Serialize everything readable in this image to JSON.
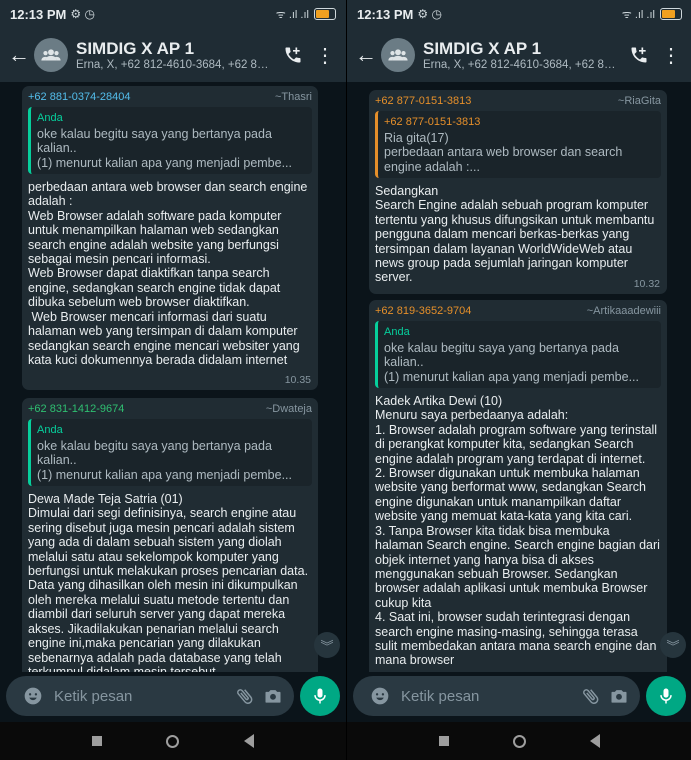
{
  "colors": {
    "accent": "#00a884",
    "background": "#0b141a",
    "bubble": "#202c33",
    "header": "#1f2c34"
  },
  "status": {
    "time": "12:13 PM",
    "icons_left": "⚙ ◷",
    "signal": "ᯤ .ıl .ıl"
  },
  "header": {
    "title": "SIMDIG X AP 1",
    "members": "Erna, X, +62 812-4610-3684, +62 815-2..."
  },
  "composer": {
    "placeholder": "Ketik pesan"
  },
  "left": {
    "messages": [
      {
        "sender": "+62 881-0374-28404",
        "alias": "~Thasri",
        "quote_author": "Anda",
        "quote_text": "oke kalau begitu saya yang bertanya pada kalian..\n(1) menurut kalian apa yang menjadi pembe...",
        "text": "perbedaan antara web browser dan search engine adalah :\nWeb Browser adalah software pada komputer untuk menampilkan halaman web sedangkan search engine adalah website yang berfungsi sebagai mesin pencari informasi.\nWeb Browser dapat diaktifkan tanpa search engine, sedangkan search engine tidak dapat dibuka sebelum web browser diaktifkan.\n Web Browser mencari informasi dari suatu halaman web yang tersimpan di dalam komputer sedangkan search engine mencari websiter yang kata kuci dokumennya berada didalam internet",
        "time": "10.35"
      },
      {
        "sender": "+62 831-1412-9674",
        "alias": "~Dwateja",
        "quote_author": "Anda",
        "quote_text": "oke kalau begitu saya yang bertanya pada kalian..\n(1) menurut kalian apa yang menjadi pembe...",
        "text": "Dewa Made Teja Satria (01)\nDimulai dari segi definisinya, search engine atau sering disebut juga mesin pencari adalah sistem yang ada di dalam sebuah sistem yang diolah melalui satu atau sekelompok komputer yang berfungsi untuk melakukan proses pencarian data. Data yang dihasilkan oleh mesin ini dikumpulkan oleh mereka melalui suatu metode tertentu dan diambil dari seluruh server yang dapat mereka akses. Jikadilakukan penarian melalui search engine ini,maka pencarian yang dilakukan sebenarnya adalah pada database yang telah terkumpul didalam mesin tersebut"
      }
    ]
  },
  "right": {
    "messages": [
      {
        "sender": "+62 877-0151-3813",
        "alias": "~RiaGita",
        "quote_author": "+62 877-0151-3813",
        "quote_text": "Ria gita(17)\nperbedaan antara web browser dan search engine adalah :...",
        "text": "Sedangkan\nSearch Engine adalah sebuah program komputer tertentu yang khusus difungsikan untuk membantu pengguna dalam mencari berkas-berkas yang tersimpan dalam layanan WorldWideWeb atau news group pada sejumlah jaringan komputer server.",
        "time": "10.32"
      },
      {
        "sender": "+62 819-3652-9704",
        "alias": "~Artikaaadewiii",
        "quote_author": "Anda",
        "quote_text": "oke kalau begitu saya yang bertanya pada kalian..\n(1) menurut kalian apa yang menjadi pembe...",
        "text": "Kadek Artika Dewi (10)\nMenuru saya perbedaanya adalah:\n1. Browser adalah program software yang terinstall di perangkat komputer kita, sedangkan Search engine adalah program yang terdapat di internet.\n2. Browser digunakan untuk membuka halaman website yang berformat www, sedangkan Search engine digunakan untuk manampilkan daftar website yang memuat kata-kata yang kita cari.\n3. Tanpa Browser kita tidak bisa membuka halaman Search engine. Search engine bagian dari objek internet yang hanya bisa di akses menggunakan sebuah Browser. Sedangkan browser adalah aplikasi untuk membuka Browser cukup kita\n4. Saat ini, browser sudah terintegrasi dengan search engine masing-masing, sehingga terasa sulit membedakan antara mana search engine dan mana browser"
      }
    ]
  }
}
